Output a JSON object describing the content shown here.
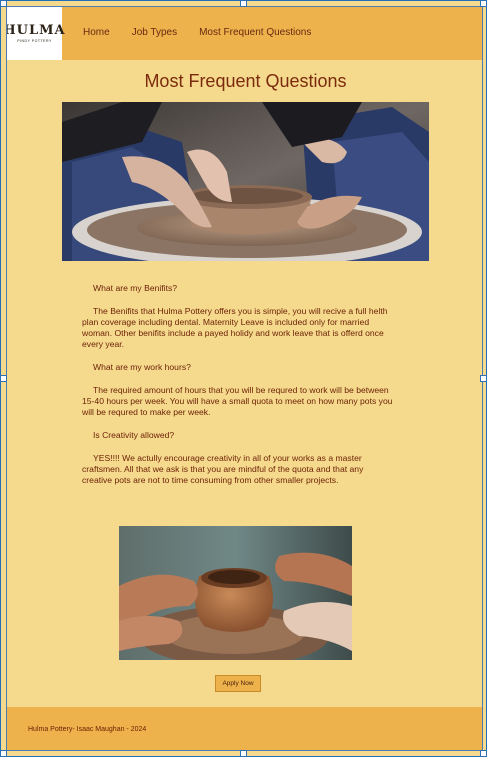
{
  "logo": {
    "main": "HULMA",
    "sub": "PINDY POTTERY"
  },
  "nav": {
    "items": [
      "Home",
      "Job Types",
      "Most Frequent Questions"
    ]
  },
  "page": {
    "title": "Most Frequent Questions"
  },
  "faq": [
    {
      "question": "What are my Benifits?",
      "answer": "The Benifits that Hulma Pottery offers you is simple, you will recive a full helth plan coverage including dental. Maternity Leave is included only for married woman. Other benifits include a payed holidy and work leave that is offerd once every year."
    },
    {
      "question": "What are my work hours?",
      "answer": "The required amount of hours that you will be requred to work will be between 15-40 hours per week. You will have a small quota to meet on how many pots you will be requred to make per week."
    },
    {
      "question": "Is Creativity allowed?",
      "answer": "YES!!!! We actully encourage creativity in all of your works as a master craftsmen. All that we ask is that you are mindful of the quota and that any creative pots are not to time consuming from other smaller projects."
    }
  ],
  "apply_button": "Apply Now",
  "footer": {
    "text": "Hulma Pottery- Isaac Maughan - 2024"
  },
  "colors": {
    "page_bg": "#f5da8d",
    "header_bg": "#edb24c",
    "text": "#6b1f05",
    "title": "#7b2a0e"
  }
}
